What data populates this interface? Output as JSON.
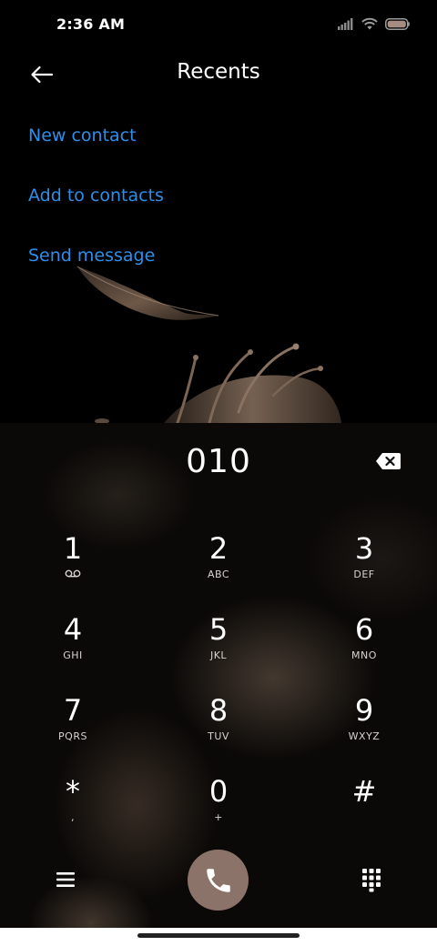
{
  "status_bar": {
    "time": "2:36 AM"
  },
  "header": {
    "title": "Recents"
  },
  "actions": [
    {
      "label": "New contact"
    },
    {
      "label": "Add to contacts"
    },
    {
      "label": "Send message"
    }
  ],
  "dialer": {
    "number": "010",
    "keys": [
      {
        "digit": "1",
        "letters": ""
      },
      {
        "digit": "2",
        "letters": "ABC"
      },
      {
        "digit": "3",
        "letters": "DEF"
      },
      {
        "digit": "4",
        "letters": "GHI"
      },
      {
        "digit": "5",
        "letters": "JKL"
      },
      {
        "digit": "6",
        "letters": "MNO"
      },
      {
        "digit": "7",
        "letters": "PQRS"
      },
      {
        "digit": "8",
        "letters": "TUV"
      },
      {
        "digit": "9",
        "letters": "WXYZ"
      },
      {
        "digit": "*",
        "letters": ","
      },
      {
        "digit": "0",
        "letters": "+"
      },
      {
        "digit": "#",
        "letters": ""
      }
    ]
  },
  "icons": {
    "back": "arrow-left-icon",
    "backspace": "backspace-icon",
    "voicemail": "voicemail-icon",
    "menu": "hamburger-menu-icon",
    "call": "phone-icon",
    "dialpad": "dialpad-icon",
    "signal": "signal-icon",
    "wifi": "wifi-icon",
    "battery": "battery-icon"
  },
  "colors": {
    "background": "#000000",
    "link": "#2e8fea",
    "call_button": "#8c736a",
    "text": "#ffffff"
  }
}
